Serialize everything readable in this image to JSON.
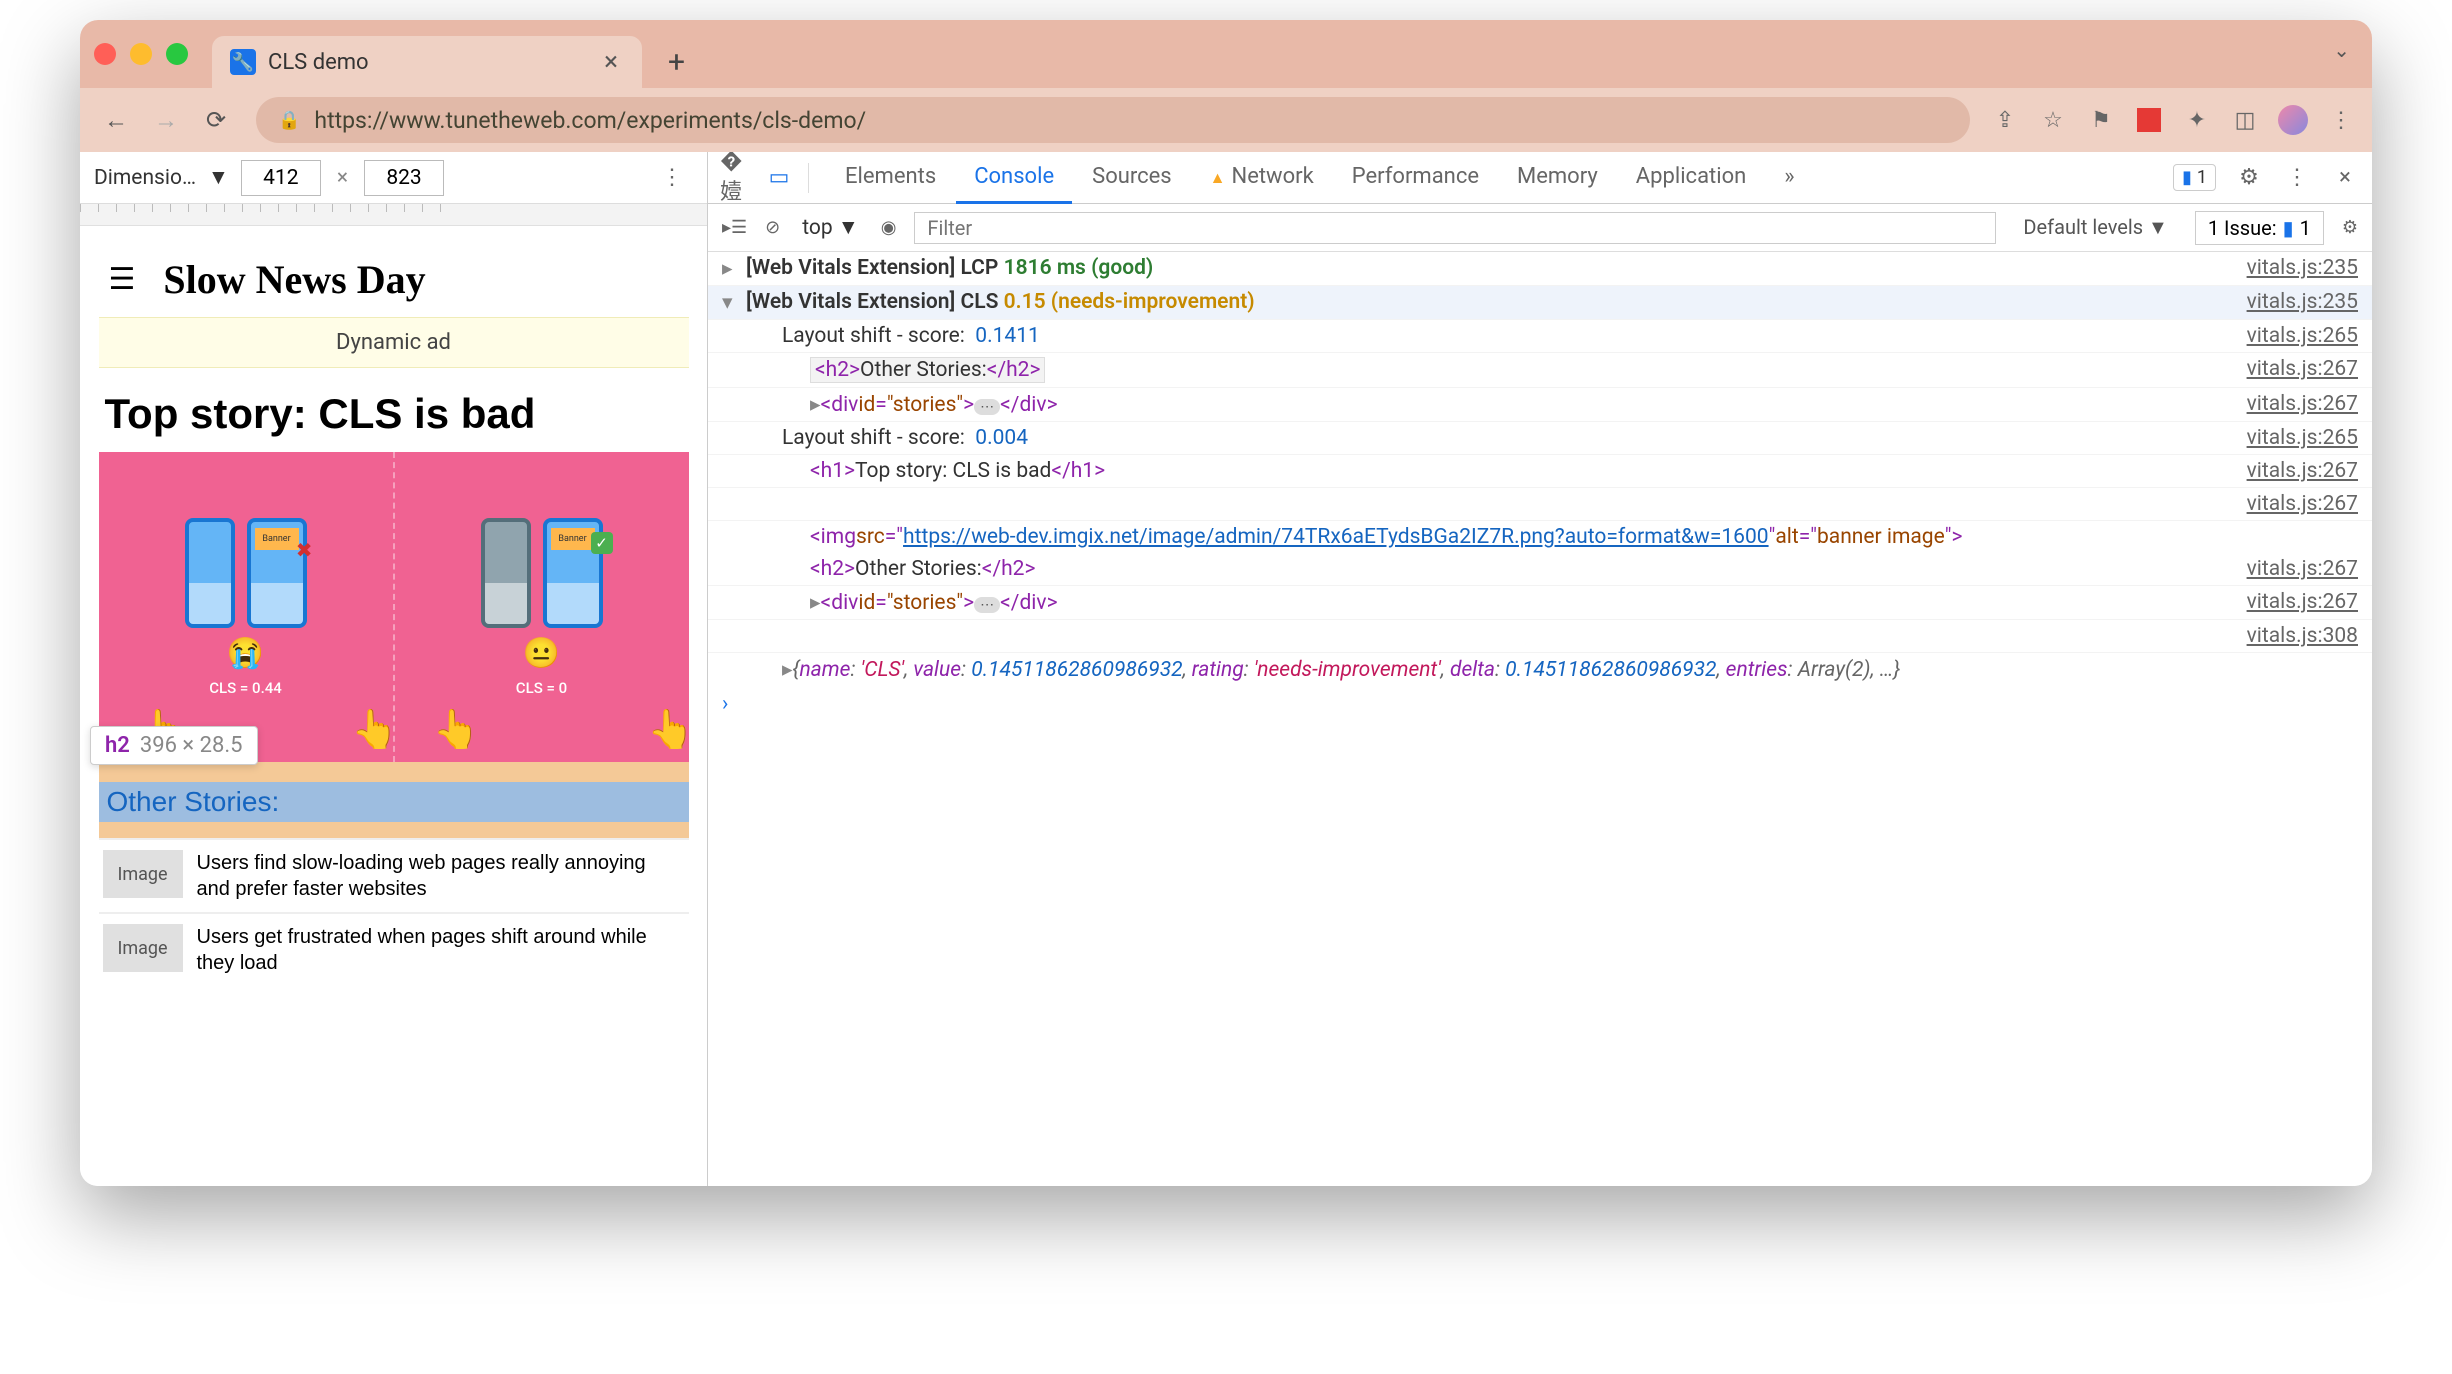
{
  "browser": {
    "tab_title": "CLS demo",
    "url": "https://www.tunetheweb.com/experiments/cls-demo/",
    "traffic": {
      "close": "#ff5f57",
      "min": "#febc2e",
      "max": "#28c840"
    }
  },
  "device_toolbar": {
    "label": "Dimensio…",
    "width": "412",
    "height": "823"
  },
  "page_content": {
    "site_title": "Slow News Day",
    "ad_text": "Dynamic ad",
    "top_story_headline": "Top story: CLS is bad",
    "banner": {
      "left_label": "Banner",
      "left_cls": "CLS = 0.44",
      "right_label": "Banner",
      "right_cls": "CLS = 0"
    },
    "other_stories_heading": "Other Stories:",
    "stories": [
      {
        "img": "Image",
        "text": "Users find slow-loading web pages really annoying and prefer faster websites"
      },
      {
        "img": "Image",
        "text": "Users get frustrated when pages shift around while they load"
      }
    ],
    "inspector_tooltip": {
      "tag": "h2",
      "dims": "396 × 28.5"
    }
  },
  "devtools": {
    "tabs": [
      "Elements",
      "Console",
      "Sources",
      "Network",
      "Performance",
      "Memory",
      "Application"
    ],
    "active_tab": "Console",
    "issue_badge": "1",
    "console_bar": {
      "context": "top",
      "filter_placeholder": "Filter",
      "levels": "Default levels",
      "issue_label": "1 Issue:",
      "issue_count": "1"
    },
    "rows": [
      {
        "type": "lcp",
        "prefix": "[Web Vitals Extension] LCP",
        "value": "1816 ms",
        "rating": "(good)",
        "link": "vitals.js:235"
      },
      {
        "type": "cls_header",
        "prefix": "[Web Vitals Extension] CLS",
        "value": "0.15",
        "rating": "(needs-improvement)",
        "link": "vitals.js:235"
      },
      {
        "type": "shift",
        "label": "Layout shift - score:",
        "value": "0.1411",
        "link": "vitals.js:265"
      },
      {
        "type": "elem_hl",
        "tag_open": "<h2>",
        "text": "Other Stories:",
        "tag_close": "</h2>",
        "link": "vitals.js:267"
      },
      {
        "type": "elem_div",
        "open": "<div ",
        "attr": "id",
        "val": "\"stories\"",
        "mid": ">",
        "close": "</div>",
        "link": "vitals.js:267"
      },
      {
        "type": "shift",
        "label": "Layout shift - score:",
        "value": "0.004",
        "link": "vitals.js:265"
      },
      {
        "type": "elem_h1",
        "tag_open": "<h1>",
        "text": "Top story: CLS is bad",
        "tag_close": "</h1>",
        "link": "vitals.js:267"
      },
      {
        "type": "link_only",
        "link": "vitals.js:267"
      },
      {
        "type": "img",
        "open": "<img ",
        "src_attr": "src",
        "src_val": "https://web-dev.imgix.net/image/admin/74TRx6aETydsBGa2IZ7R.png?auto=format&w=1600",
        "alt_attr": "alt",
        "alt_val": "banner image",
        "close": ">"
      },
      {
        "type": "elem_h2",
        "tag_open": "<h2>",
        "text": "Other Stories:",
        "tag_close": "</h2>",
        "link": "vitals.js:267"
      },
      {
        "type": "elem_div",
        "open": "<div ",
        "attr": "id",
        "val": "\"stories\"",
        "mid": ">",
        "close": "</div>",
        "link": "vitals.js:267"
      },
      {
        "type": "link_only",
        "link": "vitals.js:308"
      },
      {
        "type": "obj",
        "parts": [
          {
            "k": "name",
            "v": "'CLS'",
            "t": "rstr"
          },
          {
            "k": "value",
            "v": "0.14511862860986932",
            "t": "rnum"
          },
          {
            "k": "rating",
            "v": "'needs-improvement'",
            "t": "rstr"
          },
          {
            "k": "delta",
            "v": "0.14511862860986932",
            "t": "rnum"
          },
          {
            "k": "entries",
            "v": "Array(2)",
            "t": "ital"
          }
        ]
      }
    ]
  }
}
